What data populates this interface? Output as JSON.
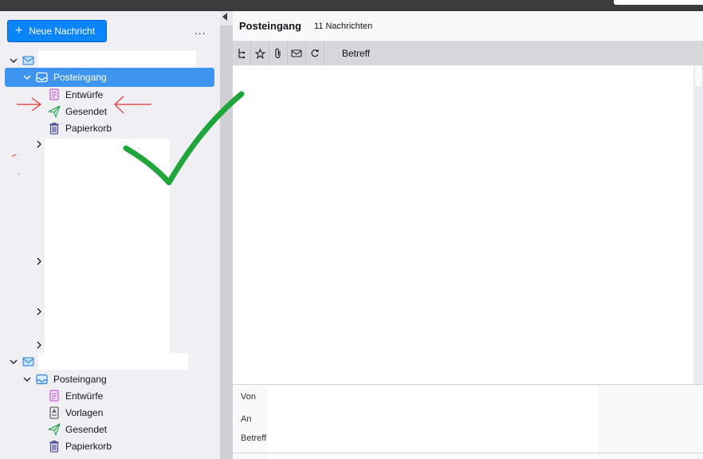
{
  "toolbar": {
    "new_message_label": "Neue Nachricht",
    "more_label": "..."
  },
  "account1": {
    "inbox": "Posteingang",
    "folders": [
      "Entwürfe",
      "Gesendet",
      "Papierkorb"
    ]
  },
  "account2": {
    "inbox": "Posteingang",
    "folders": [
      "Entwürfe",
      "Vorlagen",
      "Gesendet",
      "Papierkorb"
    ]
  },
  "main": {
    "folder_title": "Posteingang",
    "message_count": "11 Nachrichten",
    "subject_column": "Betreff"
  },
  "preview": {
    "from_label": "Von",
    "to_label": "An",
    "subject_label": "Betreff"
  },
  "colors": {
    "accent": "#0a84ff",
    "selected": "#3d95f0",
    "annotation_red": "#e03030",
    "annotation_green": "#1fa53c"
  }
}
